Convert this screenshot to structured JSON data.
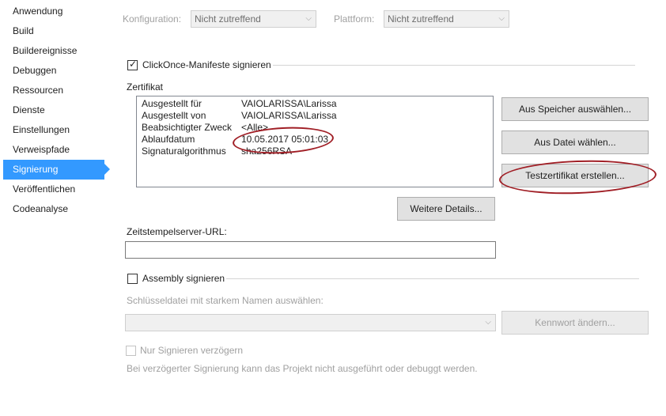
{
  "sidebar": {
    "items": [
      {
        "label": "Anwendung"
      },
      {
        "label": "Build"
      },
      {
        "label": "Buildereignisse"
      },
      {
        "label": "Debuggen"
      },
      {
        "label": "Ressourcen"
      },
      {
        "label": "Dienste"
      },
      {
        "label": "Einstellungen"
      },
      {
        "label": "Verweispfade"
      },
      {
        "label": "Signierung",
        "active": true
      },
      {
        "label": "Veröffentlichen"
      },
      {
        "label": "Codeanalyse"
      }
    ]
  },
  "toolbar": {
    "config_label": "Konfiguration:",
    "config_value": "Nicht zutreffend",
    "platform_label": "Plattform:",
    "platform_value": "Nicht zutreffend"
  },
  "clickonce": {
    "label": "ClickOnce-Manifeste signieren",
    "checked": true
  },
  "certificate": {
    "section_label": "Zertifikat",
    "rows": [
      {
        "key": "Ausgestellt für",
        "value": "VAIOLARISSA\\Larissa"
      },
      {
        "key": "Ausgestellt von",
        "value": "VAIOLARISSA\\Larissa"
      },
      {
        "key": "Beabsichtigter Zweck",
        "value": "<Alle>"
      },
      {
        "key": "Ablaufdatum",
        "value": "10.05.2017 05:01:03"
      },
      {
        "key": "Signaturalgorithmus",
        "value": "sha256RSA"
      }
    ],
    "btn_from_store": "Aus Speicher auswählen...",
    "btn_from_file": "Aus Datei wählen...",
    "btn_create_test": "Testzertifikat erstellen...",
    "btn_more_details": "Weitere Details..."
  },
  "timestamp": {
    "label": "Zeitstempelserver-URL:",
    "value": ""
  },
  "assembly": {
    "label": "Assembly signieren",
    "checked": false,
    "keyfile_label": "Schlüsseldatei mit starkem Namen auswählen:",
    "keyfile_value": "",
    "btn_change_password": "Kennwort ändern...",
    "delay_sign_label": "Nur Signieren verzögern",
    "delay_note": "Bei verzögerter Signierung kann das Projekt nicht ausgeführt oder debuggt werden."
  },
  "colors": {
    "accent": "#3399ff",
    "annotation": "#a01e25"
  }
}
